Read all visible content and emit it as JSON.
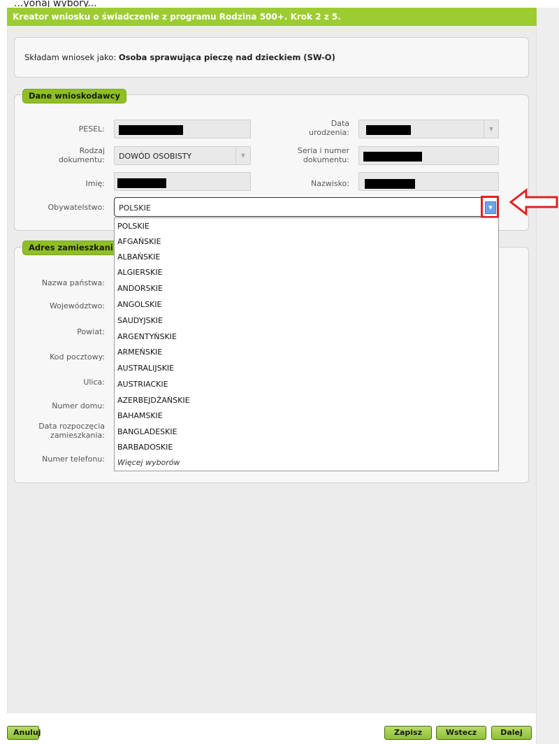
{
  "top_cut_text": "...yonaj wybory...",
  "header": {
    "title": "Kreator wniosku o świadczenie z programu Rodzina 500+. Krok 2 z 5."
  },
  "applicant": {
    "prefix": "Składam wniosek jako: ",
    "role": "Osoba sprawująca pieczę nad dzieckiem (SW-O)"
  },
  "applicant_section": {
    "legend": "Dane wnioskodawcy",
    "pesel_label": "PESEL:",
    "birthdate_label_1": "Data",
    "birthdate_label_2": "urodzenia:",
    "doc_type_label_1": "Rodzaj",
    "doc_type_label_2": "dokumentu:",
    "doc_type_value": "DOWÓD OSOBISTY",
    "doc_number_label_1": "Seria i numer",
    "doc_number_label_2": "dokumentu:",
    "firstname_label": "Imię:",
    "lastname_label": "Nazwisko:",
    "citizenship_label": "Obywatelstwo:",
    "citizenship_value": "POLSKIE"
  },
  "address_section": {
    "legend": "Adres zamieszkani",
    "country_label": "Nazwa państwa:",
    "voivodeship_label": "Województwo:",
    "county_label": "Powiat:",
    "postal_label": "Kod pocztowy:",
    "street_label": "Ulica:",
    "house_label": "Numer domu:",
    "residence_start_label_1": "Data rozpoczęcia",
    "residence_start_label_2": "zamieszkania:",
    "phone_label": "Numer telefonu:"
  },
  "citizenship_options": [
    "POLSKIE",
    "AFGAŃSKIE",
    "ALBAŃSKIE",
    "ALGIERSKIE",
    "ANDORSKIE",
    "ANGOLSKIE",
    "SAUDYJSKIE",
    "ARGENTYŃSKIE",
    "ARMEŃSKIE",
    "AUSTRALIJSKIE",
    "AUSTRIACKIE",
    "AZERBEJDŻAŃSKIE",
    "BAHAMSKIE",
    "BANGLADESKIE",
    "BARBADOSKIE"
  ],
  "more_options": "Więcej wyborów",
  "footer": {
    "cancel": "Anuluj",
    "save": "Zapisz",
    "back": "Wstecz",
    "next": "Dalej"
  },
  "colors": {
    "accent": "#9ccc32",
    "highlight": "#e02020"
  }
}
